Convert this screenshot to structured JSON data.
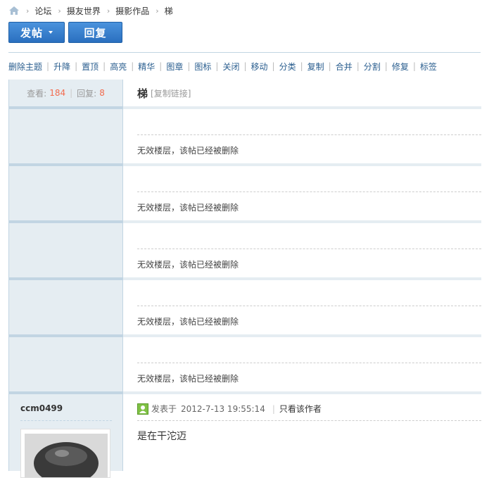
{
  "breadcrumb": {
    "items": [
      "论坛",
      "摄友世界",
      "摄影作品",
      "梯"
    ]
  },
  "buttons": {
    "post_label": "发帖",
    "reply_label": "回复"
  },
  "moderation": {
    "items": [
      "删除主题",
      "升降",
      "置顶",
      "高亮",
      "精华",
      "图章",
      "图标",
      "关闭",
      "移动",
      "分类",
      "复制",
      "合并",
      "分割",
      "修复",
      "标签"
    ]
  },
  "thread": {
    "views_label": "查看:",
    "views": "184",
    "replies_label": "回复:",
    "replies": "8",
    "title": "梯",
    "copy_link": "[复制链接]"
  },
  "deleted_posts": [
    "无效楼层，该帖已经被删除",
    "无效楼层，该帖已经被删除",
    "无效楼层，该帖已经被删除",
    "无效楼层，该帖已经被删除",
    "无效楼层，该帖已经被删除"
  ],
  "last_post": {
    "author": "ccm0499",
    "posted_prefix": "发表于",
    "time": "2012-7-13 19:55:14",
    "only_author": "只看该作者",
    "content": "是在干沱迈"
  },
  "colors": {
    "accent": "#2a6fbf",
    "link": "#2a5e8f",
    "stat_number": "#f26c4f",
    "sidebar_bg": "#e5edf2",
    "border": "#c2d5e3"
  }
}
